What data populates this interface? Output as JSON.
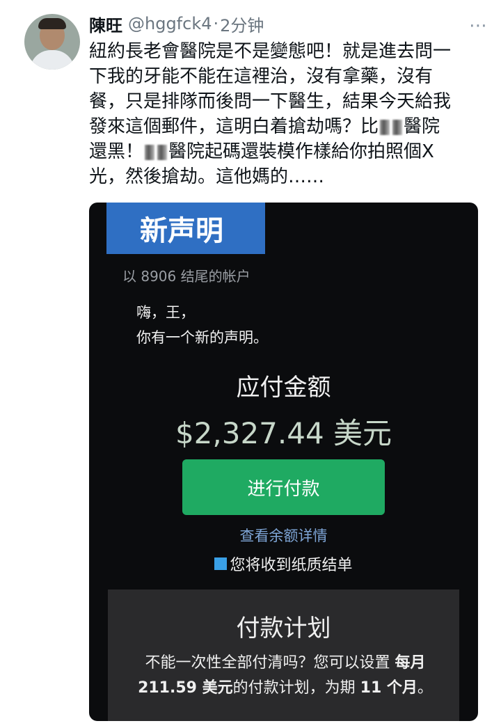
{
  "author": {
    "name": "陳旺",
    "handle": "@hggfck4",
    "separator": "·",
    "time": "2分钟"
  },
  "tweet": {
    "line1": "紐約長老會醫院是不是變態吧！就是進去問一",
    "line2": "下我的牙能不能在這裡治，沒有拿藥，沒有",
    "line3": "餐，只是排隊而後問一下醫生，結果今天給我",
    "line4a": "發來這個郵件，這明白着搶劫嗎？比",
    "line4b": "醫院",
    "line5a": "還黑！",
    "line5b": "醫院起碼還裝模作樣給你拍照個X",
    "line6": "光，然後搶劫。這他媽的……"
  },
  "statement": {
    "banner_title": "新声明",
    "account": "以 8906 结尾的帐户",
    "greeting": "嗨，王，",
    "message": "你有一个新的声明。",
    "due_label": "应付金额",
    "amount": "$2,327.44 美元",
    "pay_button": "进行付款",
    "balance_link": "查看余额详情",
    "paper_statement": "您将收到纸质结单"
  },
  "payment_plan": {
    "title": "付款计划",
    "desc_1": "不能一次性全部付清吗？您可以设置",
    "desc_bold_1": "每月 211.59 美元",
    "desc_2": "的付款计划，为期",
    "desc_bold_2": "11 个月",
    "desc_3": "。"
  },
  "colors": {
    "banner": "#2f6fc3",
    "pay_button": "#1faa62",
    "link": "#7ea5d6"
  },
  "icons": {
    "more": "more-icon"
  }
}
